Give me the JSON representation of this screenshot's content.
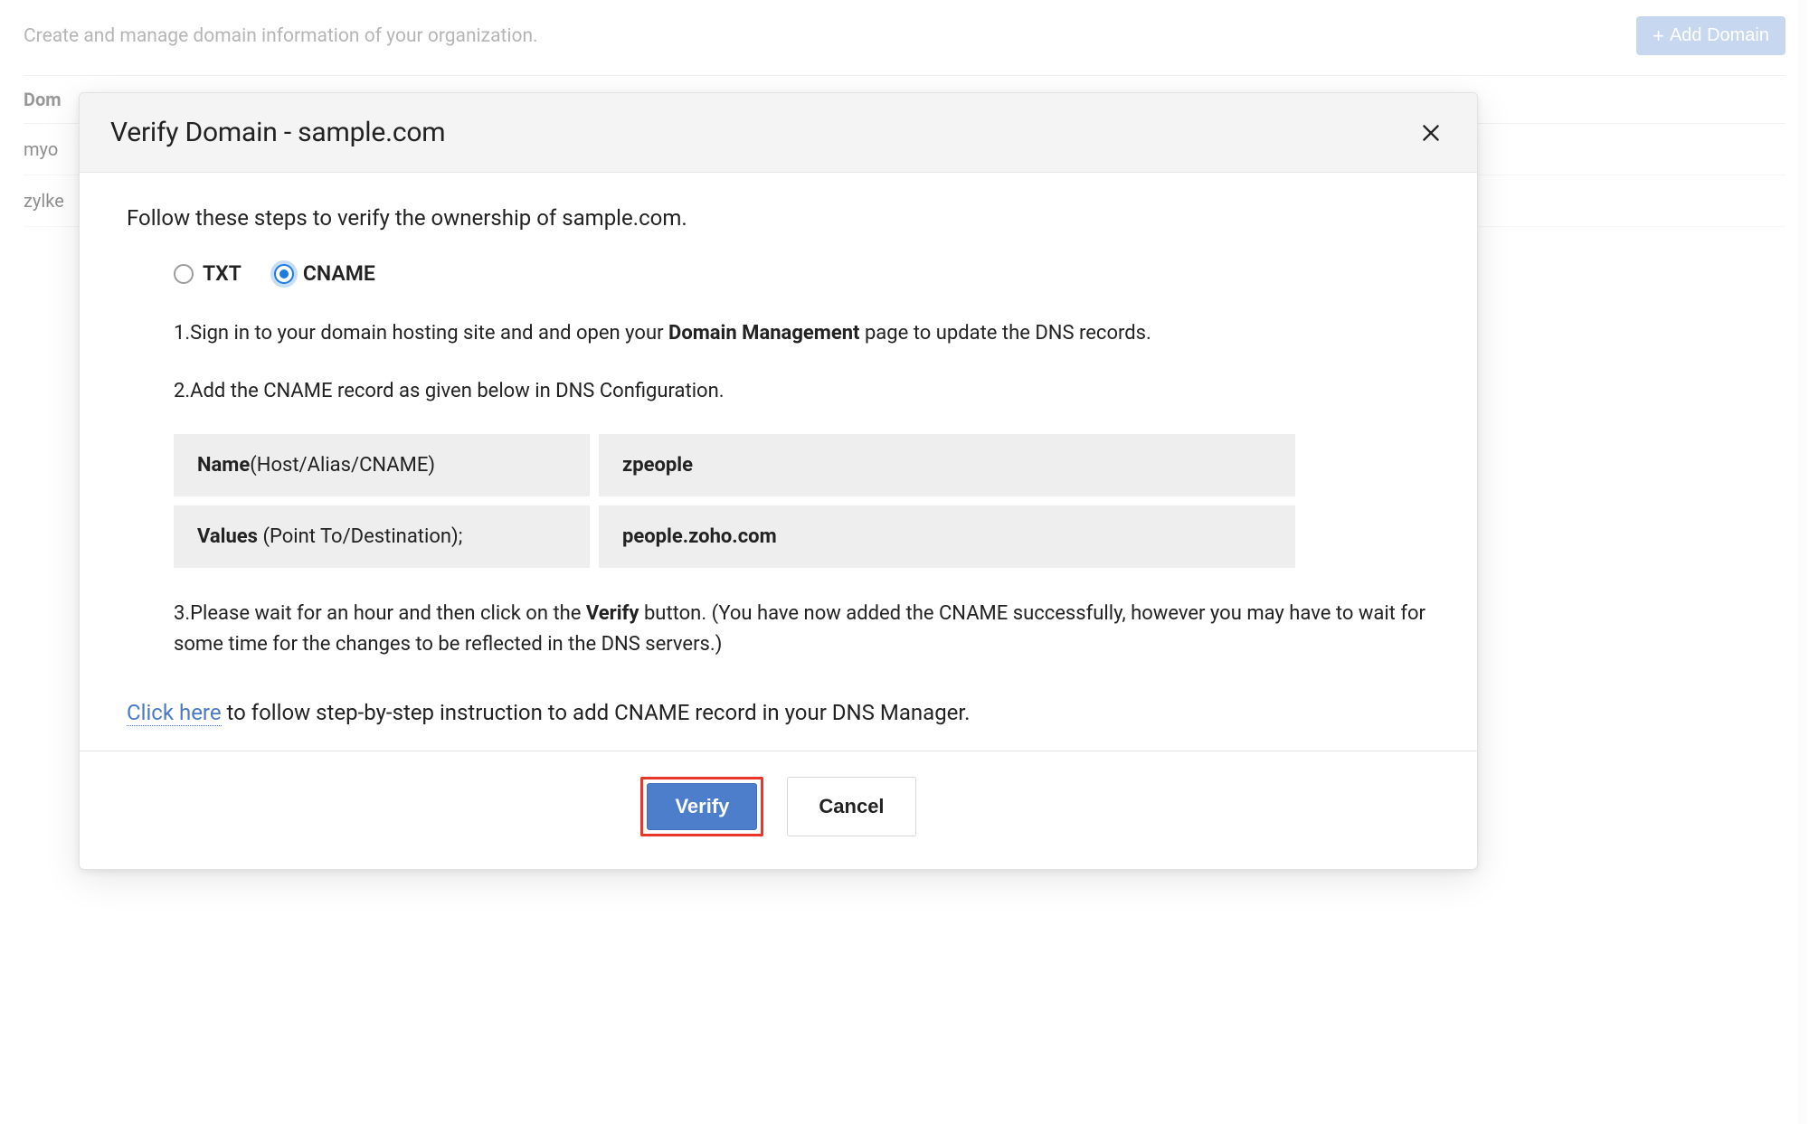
{
  "background": {
    "description": "Create and manage domain information of your organization.",
    "add_button": "Add Domain",
    "table": {
      "header_col1": "Dom",
      "rows": [
        "myo",
        "zylke"
      ]
    }
  },
  "modal": {
    "title": "Verify Domain - sample.com",
    "intro": "Follow these steps to verify the ownership of sample.com.",
    "radios": {
      "txt": "TXT",
      "cname": "CNAME",
      "selected": "cname"
    },
    "step1_pre": "1.Sign in to your domain hosting site and and open your ",
    "step1_bold": "Domain Management",
    "step1_post": " page to update the DNS records.",
    "step2": "2.Add the CNAME record as given below in DNS Configuration.",
    "dns": {
      "row1": {
        "label_strong": "Name",
        "label_rest": "(Host/Alias/CNAME)",
        "value": "zpeople"
      },
      "row2": {
        "label_strong": "Values",
        "label_rest": " (Point To/Destination);",
        "value": "people.zoho.com"
      }
    },
    "step3_pre": "3.Please wait for an hour and then click on the ",
    "step3_bold": "Verify",
    "step3_post": " button. (You have now added the CNAME successfully, however you may have to wait for some time for the changes to be reflected in the DNS servers.)",
    "helper_link": "Click here",
    "helper_rest": " to follow step-by-step instruction to add CNAME record in your DNS Manager.",
    "verify_btn": "Verify",
    "cancel_btn": "Cancel"
  }
}
